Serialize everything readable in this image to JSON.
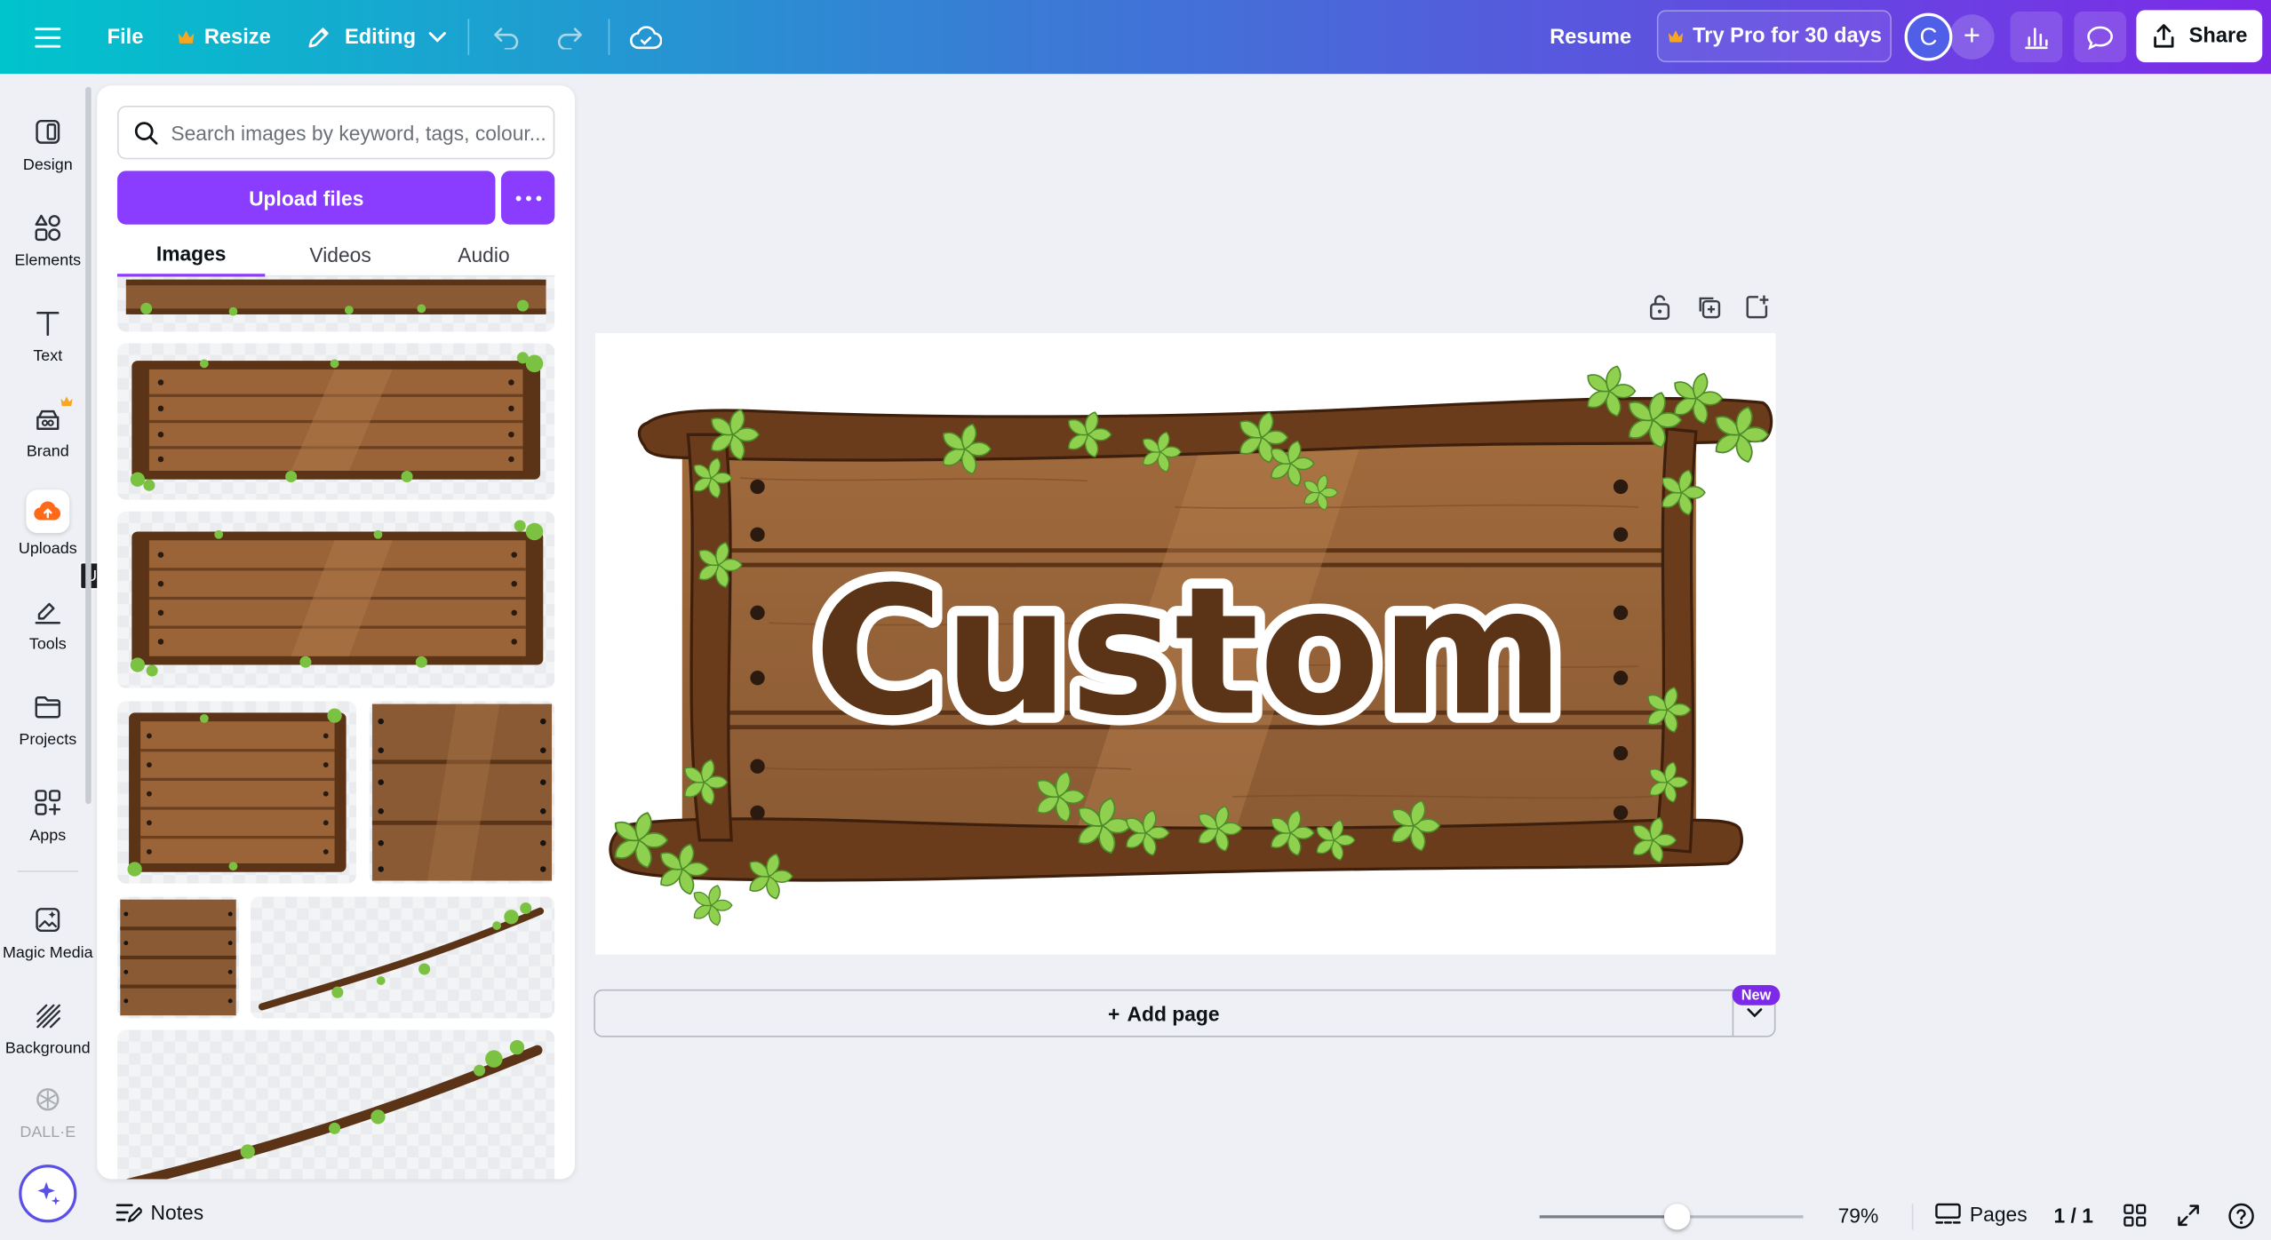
{
  "topbar": {
    "file_label": "File",
    "resize_label": "Resize",
    "editing_label": "Editing",
    "resume_label": "Resume",
    "try_pro_label": "Try Pro for 30 days",
    "avatar_initial": "C",
    "share_label": "Share"
  },
  "leftnav": {
    "items": [
      {
        "label": "Design",
        "icon": "design-icon"
      },
      {
        "label": "Elements",
        "icon": "elements-icon"
      },
      {
        "label": "Text",
        "icon": "text-icon"
      },
      {
        "label": "Brand",
        "icon": "brand-icon"
      },
      {
        "label": "Uploads",
        "icon": "cloud-upload-icon"
      },
      {
        "label": "Tools",
        "icon": "tools-icon"
      },
      {
        "label": "Projects",
        "icon": "folder-icon"
      },
      {
        "label": "Apps",
        "icon": "apps-icon"
      },
      {
        "label": "Magic Media",
        "icon": "magic-media-icon"
      },
      {
        "label": "Background",
        "icon": "background-icon"
      },
      {
        "label": "DALL·E",
        "icon": "dalle-icon"
      }
    ],
    "tooltip": "Uploads"
  },
  "panel": {
    "search_placeholder": "Search images by keyword, tags, colour...",
    "upload_label": "Upload files",
    "tabs": [
      "Images",
      "Videos",
      "Audio"
    ],
    "active_tab": "Images"
  },
  "canvas": {
    "sign_text": "Custom",
    "add_page_label": "Add page",
    "new_badge": "New"
  },
  "bottombar": {
    "notes_label": "Notes",
    "zoom_level": "79%",
    "zoom_fraction": 0.52,
    "pages_label": "Pages",
    "page_count": "1 / 1"
  },
  "colors": {
    "accent": "#8b3dff",
    "wood": "#8a5a34",
    "wood_dark": "#5b3418",
    "leaf": "#7cc242",
    "crown": "#f5a623"
  }
}
